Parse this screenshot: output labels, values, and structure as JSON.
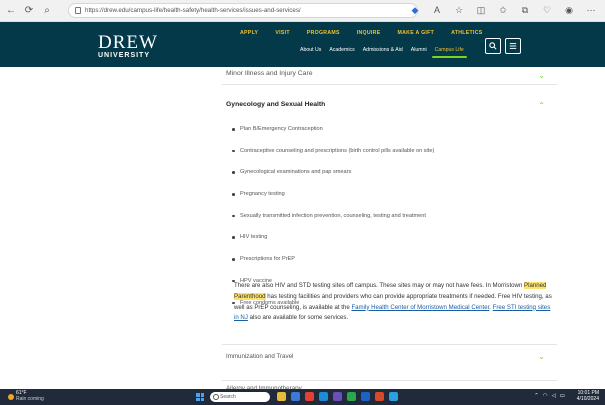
{
  "browser": {
    "url": "https://drew.edu/campus-life/health-safety/health-services/issues-and-services/",
    "url_display": "https://drew.edu/campus-life/health-safety/health-services/issues-and-services/"
  },
  "header": {
    "logo_name": "DREW",
    "logo_sub": "UNIVERSITY",
    "top_nav": [
      "APPLY",
      "VISIT",
      "PROGRAMS",
      "INQUIRE",
      "MAKE A GIFT",
      "ATHLETICS"
    ],
    "sub_nav": [
      "About Us",
      "Academics",
      "Admissions & Aid",
      "Alumni",
      "Campus Life"
    ],
    "active_sub_nav": "Campus Life",
    "colors": {
      "bg": "#033948",
      "accent": "#f1c232",
      "underline": "#7ed321"
    }
  },
  "accordion": {
    "prev_section": "Minor Illness and Injury Care",
    "open_section": "Gynecology and Sexual Health",
    "services": [
      "Plan B/Emergency Contraception",
      "Contraceptive counseling and prescriptions (birth control pills available on site)",
      "Gynecological examinations and pap smears",
      "Pregnancy testing",
      "Sexually transmitted infection prevention, counseling, testing and treatment",
      "HIV testing",
      "Prescriptions for PrEP",
      "HPV vaccine",
      "Free condoms available"
    ],
    "paragraph": {
      "part1": "There are also HIV and STD testing sites off campus.  These sites may or may not have fees.  In Morristown ",
      "highlight": "Planned Parenthood",
      "part2": " has testing facilities and providers who can provide appropriate treatments if needed.  Free HIV testing, as well as PrEP counseling, is available at the ",
      "link1": "Family Health Center of Morristown Medical Center",
      "part3": ". ",
      "link2": "Free STI testing sites in NJ",
      "part4": " also are available for some services."
    },
    "next_sections": [
      "Immunization and Travel",
      "Allergy and Immunotherapy"
    ]
  },
  "taskbar": {
    "weather_temp": "61°F",
    "weather_desc": "Rain coming",
    "search_label": "Search",
    "time": "10:01 PM",
    "date": "4/10/2024"
  }
}
